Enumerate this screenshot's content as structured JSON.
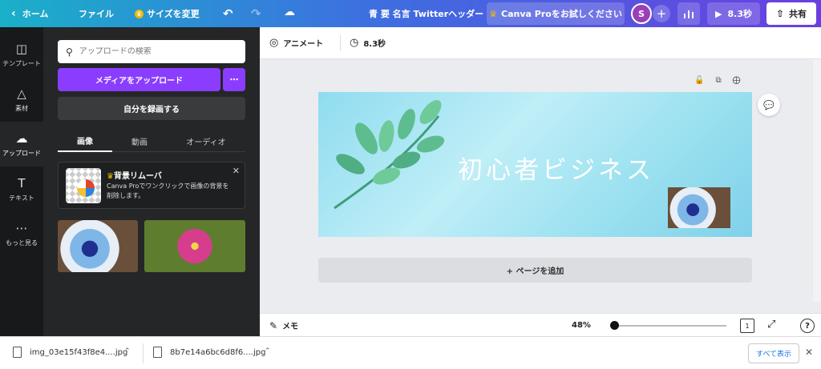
{
  "topbar": {
    "home": "ホーム",
    "file": "ファイル",
    "resize": "サイズを変更",
    "title": "青 要 名言 Twitterヘッダー",
    "pro_offer": "Canva Proをお試しください",
    "avatar_initial": "S",
    "play_duration": "8.3秒",
    "share": "共有"
  },
  "rail": {
    "items": [
      {
        "label": "テンプレート"
      },
      {
        "label": "素材"
      },
      {
        "label": "アップロード"
      },
      {
        "label": "テキスト"
      },
      {
        "label": "もっと見る"
      }
    ]
  },
  "panel": {
    "search_placeholder": "アップロードの検索",
    "upload_label": "メディアをアップロード",
    "record_label": "自分を録画する",
    "tabs": [
      {
        "label": "画像"
      },
      {
        "label": "動画"
      },
      {
        "label": "オーディオ"
      }
    ],
    "promo_title": "背景リムーバ",
    "promo_desc": "Canva Proでワンクリックで画像の背景を削除します。"
  },
  "editor": {
    "animate": "アニメート",
    "duration": "8.3秒",
    "design_text": "初心者ビジネス",
    "add_page": "+ ページを追加",
    "notes": "メモ",
    "zoom": "48%",
    "zoom_fraction": 0.48,
    "page_count": "1"
  },
  "downloads": {
    "files": [
      {
        "name": "img_03e15f43f8e4....jpg"
      },
      {
        "name": "8b7e14a6bc6d8f6....jpg"
      }
    ],
    "show_all": "すべて表示"
  },
  "colors": {
    "accent": "#8b3dff",
    "topbar_start": "#1ab0c9",
    "topbar_end": "#6a3fe0",
    "panel_bg": "#252627"
  }
}
